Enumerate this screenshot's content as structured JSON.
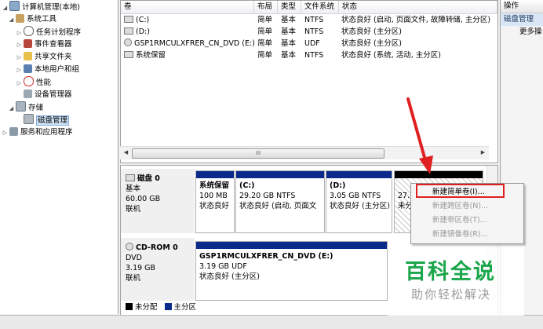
{
  "tree": {
    "items": [
      {
        "label": "计算机管理(本地)",
        "expander": "◢"
      },
      {
        "label": "系统工具",
        "expander": "◢"
      },
      {
        "label": "任务计划程序",
        "expander": "▷"
      },
      {
        "label": "事件查看器",
        "expander": "▷"
      },
      {
        "label": "共享文件夹",
        "expander": "▷"
      },
      {
        "label": "本地用户和组",
        "expander": "▷"
      },
      {
        "label": "性能",
        "expander": "▷"
      },
      {
        "label": "设备管理器",
        "expander": ""
      },
      {
        "label": "存储",
        "expander": "◢"
      },
      {
        "label": "磁盘管理",
        "expander": ""
      },
      {
        "label": "服务和应用程序",
        "expander": "▷"
      }
    ]
  },
  "volume_list": {
    "columns": [
      "卷",
      "布局",
      "类型",
      "文件系统",
      "状态"
    ],
    "rows": [
      {
        "volume": "(C:)",
        "layout": "简单",
        "type": "基本",
        "fs": "NTFS",
        "status": "状态良好 (启动, 页面文件, 故障转储, 主分区)"
      },
      {
        "volume": "(D:)",
        "layout": "简单",
        "type": "基本",
        "fs": "NTFS",
        "status": "状态良好 (主分区)"
      },
      {
        "volume": "GSP1RMCULXFRER_CN_DVD (E:)",
        "layout": "简单",
        "type": "基本",
        "fs": "UDF",
        "status": "状态良好 (主分区)"
      },
      {
        "volume": "系统保留",
        "layout": "简单",
        "type": "基本",
        "fs": "NTFS",
        "status": "状态良好 (系统, 活动, 主分区)"
      }
    ],
    "scroll_grip": "III",
    "scroll_left": "◀",
    "scroll_right": "▶"
  },
  "disks": {
    "disk0": {
      "name": "磁盘 0",
      "kind": "基本",
      "size": "60.00 GB",
      "state": "联机",
      "partitions": [
        {
          "name": "系统保留",
          "size": "100 MB",
          "status": "状态良好"
        },
        {
          "name": "(C:)",
          "size": "29.20 GB NTFS",
          "status": "状态良好 (启动, 页面文"
        },
        {
          "name": "(D:)",
          "size": "3.05 GB NTFS",
          "status": "状态良好 (主分区)"
        },
        {
          "name": "",
          "size": "27.6",
          "status": "未分"
        }
      ]
    },
    "cdrom0": {
      "name": "CD-ROM 0",
      "kind": "DVD",
      "size": "3.19 GB",
      "state": "联机",
      "partition": {
        "name": "GSP1RMCULXFRER_CN_DVD  (E:)",
        "size": "3.19 GB UDF",
        "status": "状态良好 (主分区)"
      }
    },
    "legend": [
      {
        "label": "未分配",
        "color": "#000000"
      },
      {
        "label": "主分区",
        "color": "#0a2a8c"
      }
    ]
  },
  "actions": {
    "header": "操作",
    "section": "磁盘管理",
    "more": "更多操"
  },
  "context_menu": {
    "items": [
      {
        "label": "新建简单卷(I)...",
        "enabled": true
      },
      {
        "label": "新建跨区卷(N)...",
        "enabled": false
      },
      {
        "label": "新建带区卷(T)...",
        "enabled": false
      },
      {
        "label": "新建镜像卷(R)...",
        "enabled": false
      }
    ]
  },
  "watermark": {
    "title": "百科全说",
    "subtitle": "助你轻松解决"
  },
  "colors": {
    "primary_partition": "#0a2a8c",
    "unallocated": "#000000",
    "highlight": "#e02020",
    "arrow": "#e02020",
    "brand_green": "#1aa64a"
  }
}
